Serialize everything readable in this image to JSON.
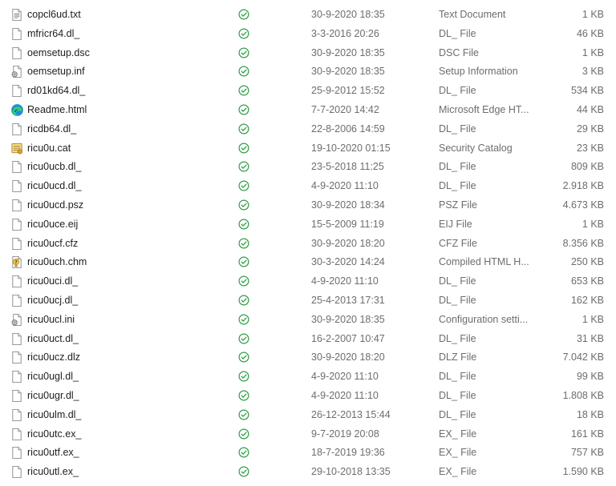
{
  "files": [
    {
      "name": "copcl6ud.txt",
      "date": "30-9-2020 18:35",
      "type": "Text Document",
      "size": "1 KB",
      "icon": "text-file-icon",
      "status": "sync-ok-icon"
    },
    {
      "name": "mfricr64.dl_",
      "date": "3-3-2016 20:26",
      "type": "DL_ File",
      "size": "46 KB",
      "icon": "generic-file-icon",
      "status": "sync-ok-icon"
    },
    {
      "name": "oemsetup.dsc",
      "date": "30-9-2020 18:35",
      "type": "DSC File",
      "size": "1 KB",
      "icon": "generic-file-icon",
      "status": "sync-ok-icon"
    },
    {
      "name": "oemsetup.inf",
      "date": "30-9-2020 18:35",
      "type": "Setup Information",
      "size": "3 KB",
      "icon": "settings-file-icon",
      "status": "sync-ok-icon"
    },
    {
      "name": "rd01kd64.dl_",
      "date": "25-9-2012 15:52",
      "type": "DL_ File",
      "size": "534 KB",
      "icon": "generic-file-icon",
      "status": "sync-ok-icon"
    },
    {
      "name": "Readme.html",
      "date": "7-7-2020 14:42",
      "type": "Microsoft Edge HT...",
      "size": "44 KB",
      "icon": "edge-browser-icon",
      "status": "sync-ok-icon"
    },
    {
      "name": "ricdb64.dl_",
      "date": "22-8-2006 14:59",
      "type": "DL_ File",
      "size": "29 KB",
      "icon": "generic-file-icon",
      "status": "sync-ok-icon"
    },
    {
      "name": "ricu0u.cat",
      "date": "19-10-2020 01:15",
      "type": "Security Catalog",
      "size": "23 KB",
      "icon": "security-catalog-icon",
      "status": "sync-ok-icon"
    },
    {
      "name": "ricu0ucb.dl_",
      "date": "23-5-2018 11:25",
      "type": "DL_ File",
      "size": "809 KB",
      "icon": "generic-file-icon",
      "status": "sync-ok-icon"
    },
    {
      "name": "ricu0ucd.dl_",
      "date": "4-9-2020 11:10",
      "type": "DL_ File",
      "size": "2.918 KB",
      "icon": "generic-file-icon",
      "status": "sync-ok-icon"
    },
    {
      "name": "ricu0ucd.psz",
      "date": "30-9-2020 18:34",
      "type": "PSZ File",
      "size": "4.673 KB",
      "icon": "generic-file-icon",
      "status": "sync-ok-icon"
    },
    {
      "name": "ricu0uce.eij",
      "date": "15-5-2009 11:19",
      "type": "EIJ File",
      "size": "1 KB",
      "icon": "generic-file-icon",
      "status": "sync-ok-icon"
    },
    {
      "name": "ricu0ucf.cfz",
      "date": "30-9-2020 18:20",
      "type": "CFZ File",
      "size": "8.356 KB",
      "icon": "generic-file-icon",
      "status": "sync-ok-icon"
    },
    {
      "name": "ricu0uch.chm",
      "date": "30-3-2020 14:24",
      "type": "Compiled HTML H...",
      "size": "250 KB",
      "icon": "help-file-icon",
      "status": "sync-ok-icon"
    },
    {
      "name": "ricu0uci.dl_",
      "date": "4-9-2020 11:10",
      "type": "DL_ File",
      "size": "653 KB",
      "icon": "generic-file-icon",
      "status": "sync-ok-icon"
    },
    {
      "name": "ricu0ucj.dl_",
      "date": "25-4-2013 17:31",
      "type": "DL_ File",
      "size": "162 KB",
      "icon": "generic-file-icon",
      "status": "sync-ok-icon"
    },
    {
      "name": "ricu0ucl.ini",
      "date": "30-9-2020 18:35",
      "type": "Configuration setti...",
      "size": "1 KB",
      "icon": "settings-file-icon",
      "status": "sync-ok-icon"
    },
    {
      "name": "ricu0uct.dl_",
      "date": "16-2-2007 10:47",
      "type": "DL_ File",
      "size": "31 KB",
      "icon": "generic-file-icon",
      "status": "sync-ok-icon"
    },
    {
      "name": "ricu0ucz.dlz",
      "date": "30-9-2020 18:20",
      "type": "DLZ File",
      "size": "7.042 KB",
      "icon": "generic-file-icon",
      "status": "sync-ok-icon"
    },
    {
      "name": "ricu0ugl.dl_",
      "date": "4-9-2020 11:10",
      "type": "DL_ File",
      "size": "99 KB",
      "icon": "generic-file-icon",
      "status": "sync-ok-icon"
    },
    {
      "name": "ricu0ugr.dl_",
      "date": "4-9-2020 11:10",
      "type": "DL_ File",
      "size": "1.808 KB",
      "icon": "generic-file-icon",
      "status": "sync-ok-icon"
    },
    {
      "name": "ricu0ulm.dl_",
      "date": "26-12-2013 15:44",
      "type": "DL_ File",
      "size": "18 KB",
      "icon": "generic-file-icon",
      "status": "sync-ok-icon"
    },
    {
      "name": "ricu0utc.ex_",
      "date": "9-7-2019 20:08",
      "type": "EX_ File",
      "size": "161 KB",
      "icon": "generic-file-icon",
      "status": "sync-ok-icon"
    },
    {
      "name": "ricu0utf.ex_",
      "date": "18-7-2019 19:36",
      "type": "EX_ File",
      "size": "757 KB",
      "icon": "generic-file-icon",
      "status": "sync-ok-icon"
    },
    {
      "name": "ricu0utl.ex_",
      "date": "29-10-2018 13:35",
      "type": "EX_ File",
      "size": "1.590 KB",
      "icon": "generic-file-icon",
      "status": "sync-ok-icon"
    }
  ],
  "colors": {
    "status_ok": "#2f9e44",
    "name_text": "#1e1e1e",
    "detail_text": "#6d6d6d",
    "hover": "#e5f3ff"
  }
}
